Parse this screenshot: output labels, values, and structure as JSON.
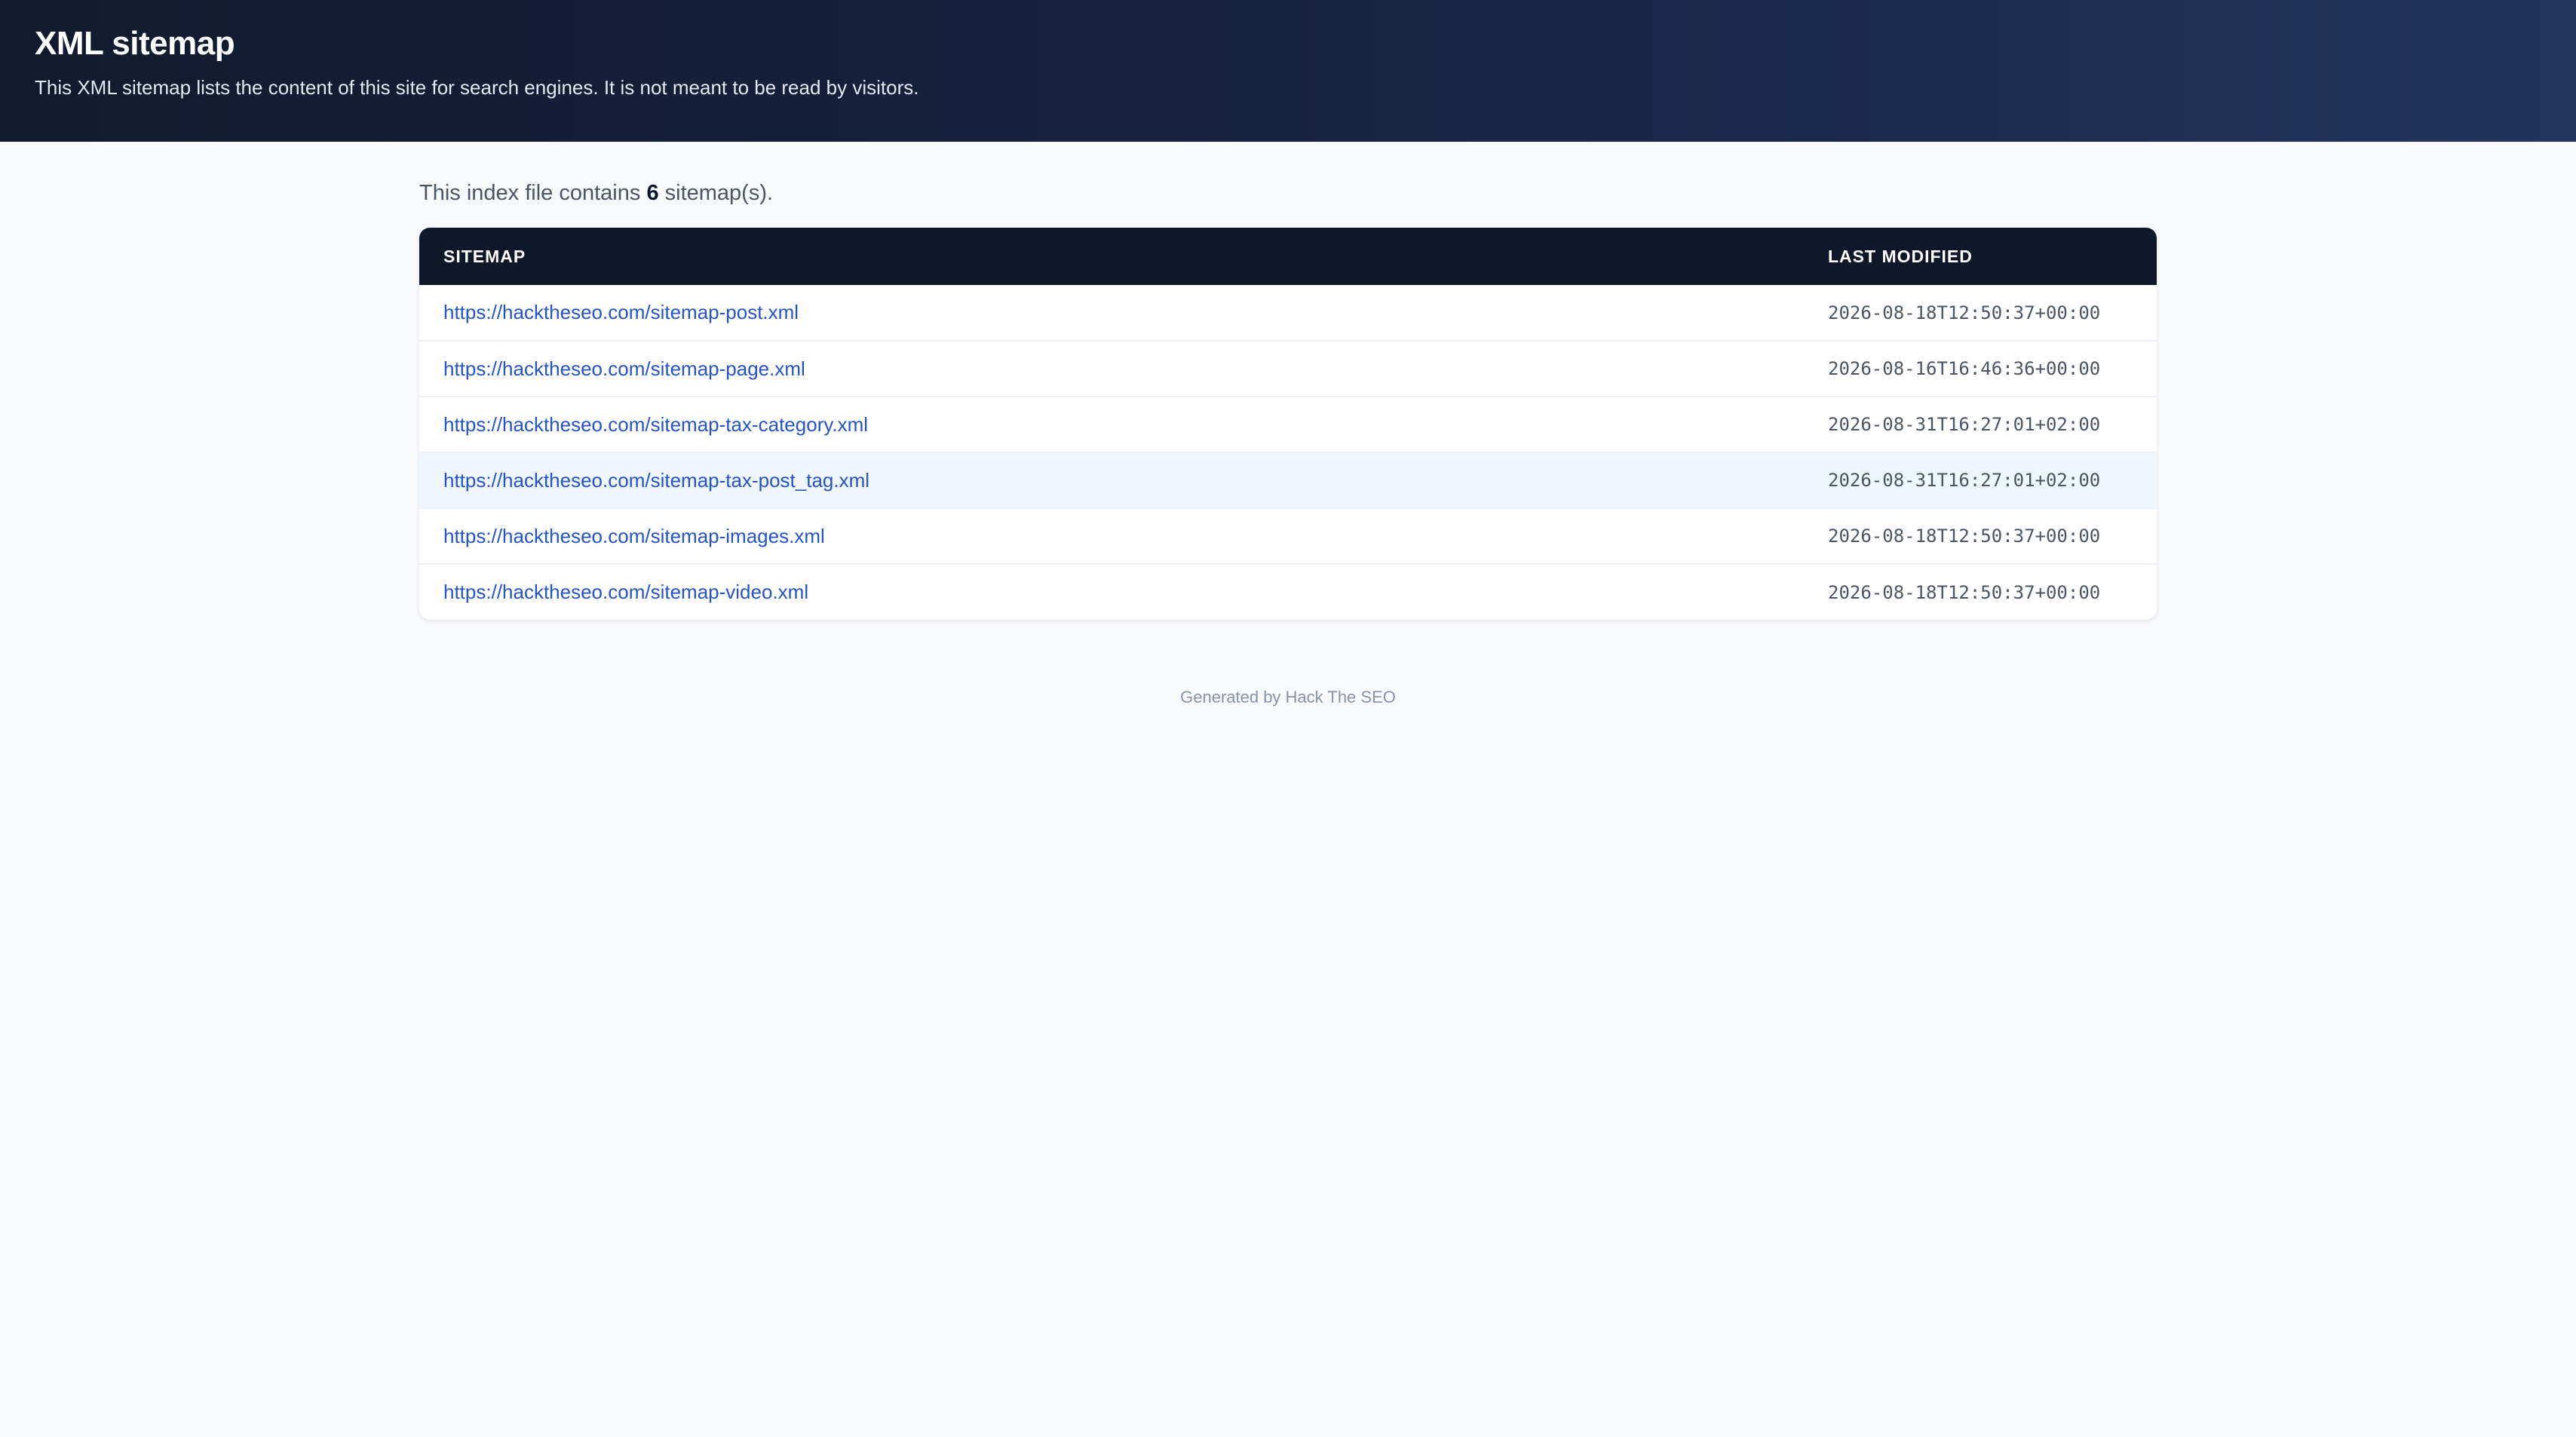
{
  "header": {
    "title": "XML sitemap",
    "description": "This XML sitemap lists the content of this site for search engines. It is not meant to be read by visitors."
  },
  "summary": {
    "prefix": "This index file contains ",
    "count": "6",
    "suffix": " sitemap(s)."
  },
  "table": {
    "columns": [
      "SITEMAP",
      "LAST MODIFIED"
    ],
    "rows": [
      {
        "url": "https://hacktheseo.com/sitemap-post.xml",
        "modified": "2026-08-18T12:50:37+00:00"
      },
      {
        "url": "https://hacktheseo.com/sitemap-page.xml",
        "modified": "2026-08-16T16:46:36+00:00"
      },
      {
        "url": "https://hacktheseo.com/sitemap-tax-category.xml",
        "modified": "2026-08-31T16:27:01+02:00"
      },
      {
        "url": "https://hacktheseo.com/sitemap-tax-post_tag.xml",
        "modified": "2026-08-31T16:27:01+02:00"
      },
      {
        "url": "https://hacktheseo.com/sitemap-images.xml",
        "modified": "2026-08-18T12:50:37+00:00"
      },
      {
        "url": "https://hacktheseo.com/sitemap-video.xml",
        "modified": "2026-08-18T12:50:37+00:00"
      }
    ],
    "highlighted_row": 3
  },
  "footer": {
    "text": "Generated by Hack The SEO"
  },
  "colors": {
    "header_bg": "#111a2e",
    "table_header_bg": "#0f172a",
    "link": "#2454c7",
    "highlight_row": "#f0f6fd"
  }
}
